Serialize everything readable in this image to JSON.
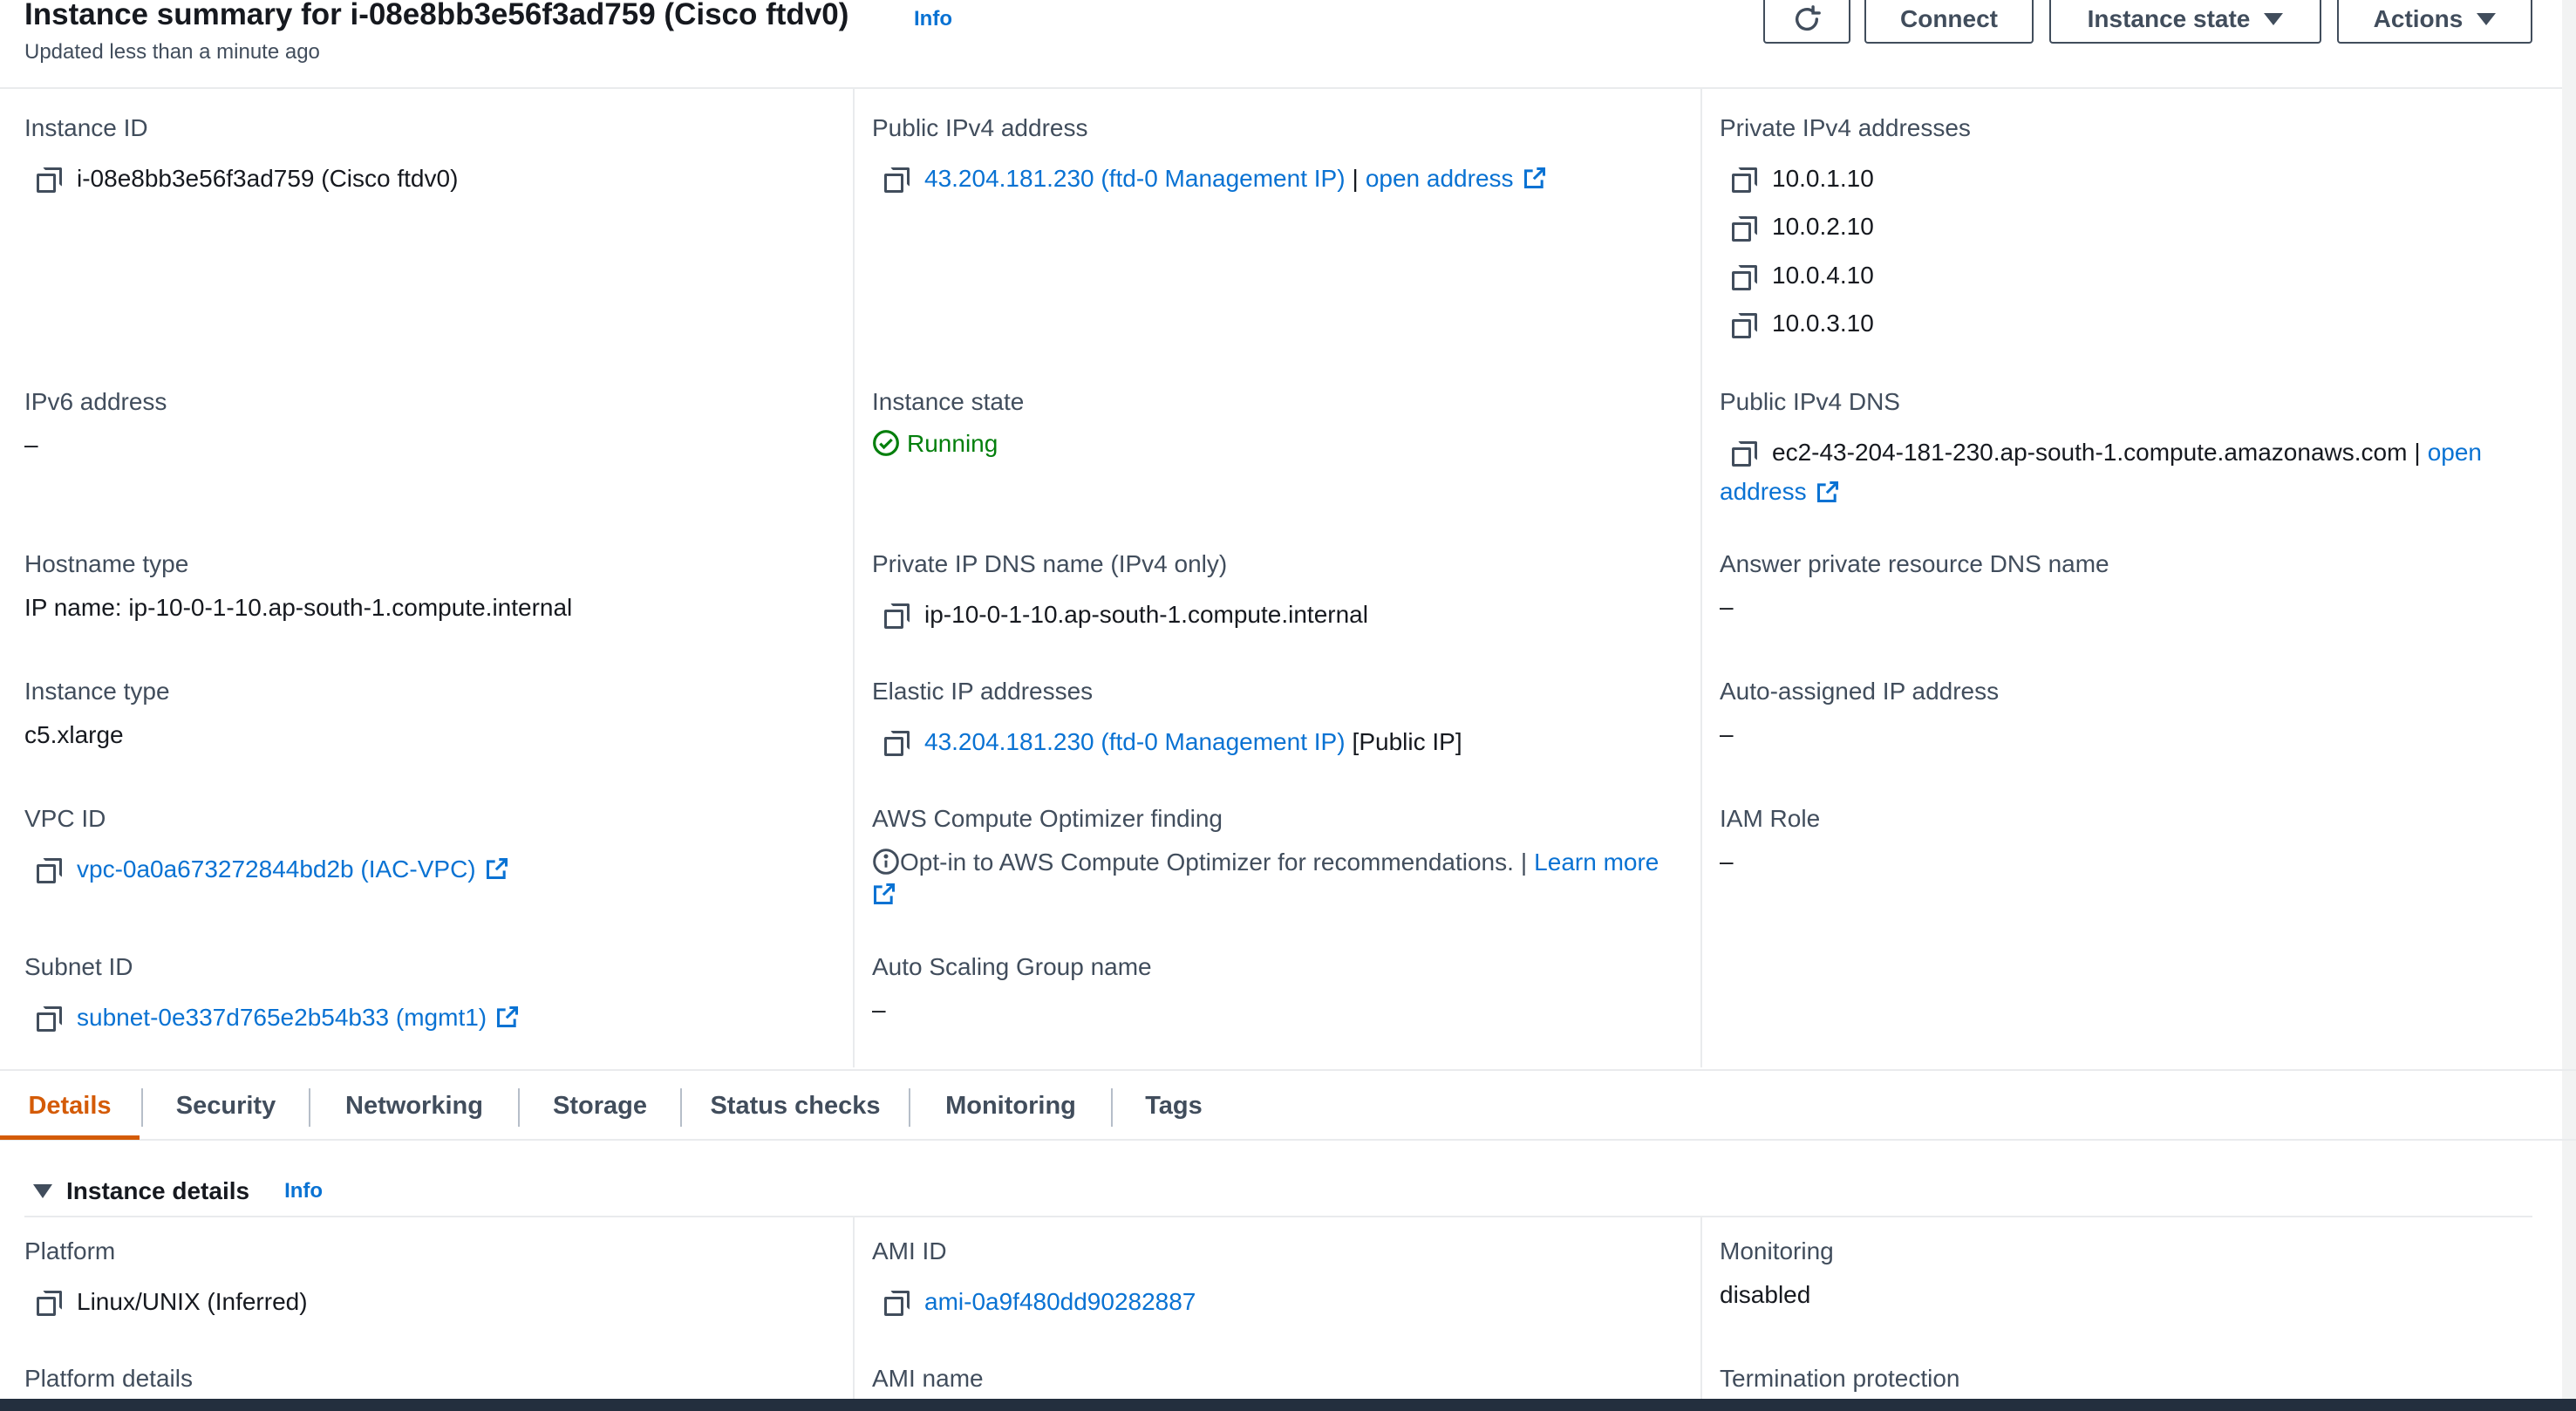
{
  "header": {
    "title": "Instance summary for i-08e8bb3e56f3ad759 (Cisco ftdv0)",
    "info": "Info",
    "updated": "Updated less than a minute ago",
    "buttons": {
      "connect": "Connect",
      "instance_state": "Instance state",
      "actions": "Actions"
    }
  },
  "summary": {
    "instance_id": {
      "label": "Instance ID",
      "value": "i-08e8bb3e56f3ad759 (Cisco ftdv0)"
    },
    "public_ipv4": {
      "label": "Public IPv4 address",
      "value": "43.204.181.230 (ftd-0 Management IP)",
      "sep": "|",
      "open": "open address"
    },
    "private_ipv4": {
      "label": "Private IPv4 addresses",
      "values": [
        "10.0.1.10",
        "10.0.2.10",
        "10.0.4.10",
        "10.0.3.10"
      ]
    },
    "ipv6": {
      "label": "IPv6 address",
      "value": "–"
    },
    "instance_state": {
      "label": "Instance state",
      "value": "Running"
    },
    "public_dns": {
      "label": "Public IPv4 DNS",
      "value": "ec2-43-204-181-230.ap-south-1.compute.amazonaws.com",
      "sep": "|",
      "open1": "open",
      "open2": "address"
    },
    "hostname_type": {
      "label": "Hostname type",
      "value": "IP name: ip-10-0-1-10.ap-south-1.compute.internal"
    },
    "private_dns": {
      "label": "Private IP DNS name (IPv4 only)",
      "value": "ip-10-0-1-10.ap-south-1.compute.internal"
    },
    "answer_dns": {
      "label": "Answer private resource DNS name",
      "value": "–"
    },
    "instance_type": {
      "label": "Instance type",
      "value": "c5.xlarge"
    },
    "elastic_ip": {
      "label": "Elastic IP addresses",
      "value": "43.204.181.230 (ftd-0 Management IP)",
      "suffix": "[Public IP]"
    },
    "auto_ip": {
      "label": "Auto-assigned IP address",
      "value": "–"
    },
    "vpc_id": {
      "label": "VPC ID",
      "value": "vpc-0a0a673272844bd2b (IAC-VPC)"
    },
    "optimizer": {
      "label": "AWS Compute Optimizer finding",
      "value": "Opt-in to AWS Compute Optimizer for recommendations.",
      "sep": "|",
      "learn": "Learn more"
    },
    "iam_role": {
      "label": "IAM Role",
      "value": "–"
    },
    "subnet_id": {
      "label": "Subnet ID",
      "value": "subnet-0e337d765e2b54b33 (mgmt1)"
    },
    "asg": {
      "label": "Auto Scaling Group name",
      "value": "–"
    }
  },
  "tabs": [
    "Details",
    "Security",
    "Networking",
    "Storage",
    "Status checks",
    "Monitoring",
    "Tags"
  ],
  "details": {
    "section_title": "Instance details",
    "info": "Info",
    "platform": {
      "label": "Platform",
      "value": "Linux/UNIX (Inferred)"
    },
    "ami_id": {
      "label": "AMI ID",
      "value": "ami-0a9f480dd90282887"
    },
    "monitoring": {
      "label": "Monitoring",
      "value": "disabled"
    },
    "platform_details": {
      "label": "Platform details"
    },
    "ami_name": {
      "label": "AMI name"
    },
    "termination": {
      "label": "Termination protection"
    }
  },
  "colors": {
    "link": "#0972d3",
    "running": "#037f0c",
    "active_tab": "#d45b07"
  }
}
